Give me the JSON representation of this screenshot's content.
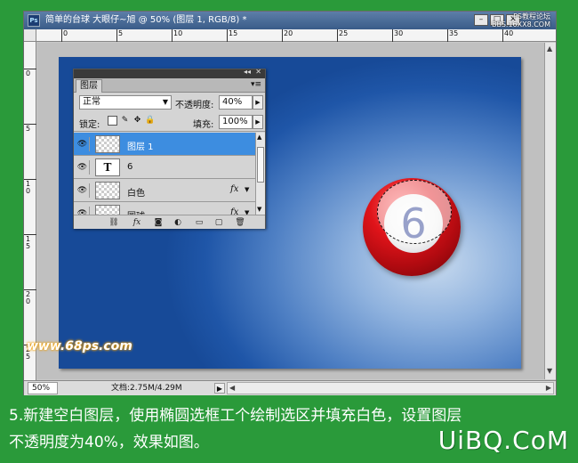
{
  "window": {
    "app_icon": "Ps",
    "title": "简单的台球   大眼仔~旭 @ 50% (图层 1, RGB/8) *",
    "minimize_icon": "minimize-icon",
    "maximize_icon": "maximize-icon",
    "close_icon": "close-icon",
    "watermark_top_line1": "PS教程论坛",
    "watermark_top_line2": "BBS.16XX8.COM"
  },
  "rulers": {
    "horizontal_ticks": [
      "0",
      "5",
      "10",
      "15",
      "20",
      "25",
      "30",
      "35",
      "40"
    ],
    "vertical_ticks": [
      "0",
      "5",
      "1 0",
      "1 5",
      "2 0",
      "2 5"
    ]
  },
  "canvas": {
    "site_text": "www.68ps.com",
    "ball_number": "6"
  },
  "statusbar": {
    "zoom": "50%",
    "doc_info": "文档:2.75M/4.29M",
    "play_icon": "▶",
    "scroll_left": "◀",
    "scroll_right": "▶"
  },
  "layers_panel": {
    "tab_label": "图层",
    "menu_icon": "▾≡",
    "blend_mode": "正常",
    "opacity_label": "不透明度:",
    "opacity_value": "40%",
    "lock_label": "锁定:",
    "fill_label": "填充:",
    "fill_value": "100%",
    "layers": [
      {
        "name": "图层 1",
        "selected": true,
        "thumb": "transparent",
        "fx": ""
      },
      {
        "name": "6",
        "selected": false,
        "thumb": "T",
        "fx": ""
      },
      {
        "name": "白色",
        "selected": false,
        "thumb": "transparent",
        "fx": "fx"
      },
      {
        "name": "圆球",
        "selected": false,
        "thumb": "transparent",
        "fx": "fx"
      }
    ],
    "footer_icons": [
      "link-icon",
      "fx-icon",
      "mask-icon",
      "adjustment-icon",
      "group-icon",
      "new-layer-icon",
      "trash-icon"
    ]
  },
  "caption": {
    "line1": "5.新建空白图层，使用椭圆选框工个绘制选区并填充白色，设置图层",
    "line2": "不透明度为40%，效果如图。",
    "brand": "UiBQ.CoM"
  }
}
